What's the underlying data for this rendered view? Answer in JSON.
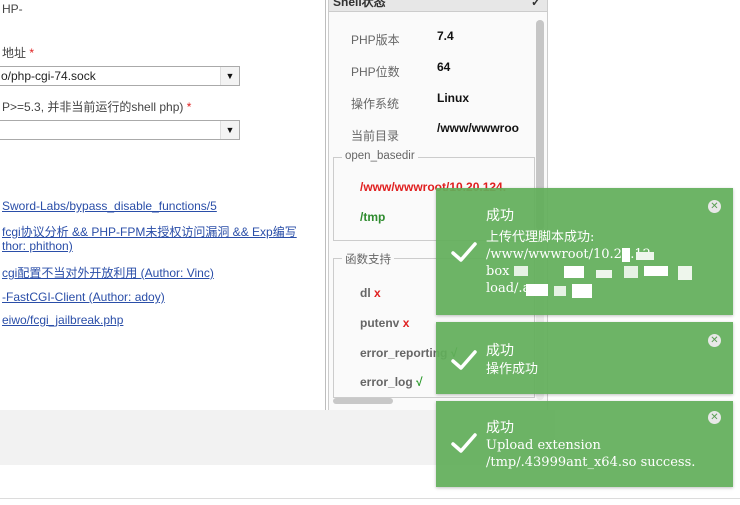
{
  "form": {
    "top_label": "HP-",
    "address_label": "地址",
    "required_mark": "*",
    "socket_value": "o/php-cgi-74.sock",
    "php_label": "P>=5.3, 并非当前运行的shell php)",
    "php_value": "",
    "dropdown_arrow": "▼"
  },
  "links": [
    "Sword-Labs/bypass_disable_functions/5",
    "fcgi协议分析 && PHP-FPM未授权访问漏洞 && Exp编写",
    "thor: phithon)",
    "cgi配置不当对外开放利用 (Author: Vinc)",
    "-FastCGI-Client (Author: adoy)",
    "eiwo/fcgi_jailbreak.php"
  ],
  "info_panel": {
    "header": "Shell状态",
    "header_icon": "✓",
    "rows": [
      {
        "key": "PHP版本",
        "value": "7.4"
      },
      {
        "key": "PHP位数",
        "value": "64"
      },
      {
        "key": "操作系统",
        "value": "Linux"
      },
      {
        "key": "当前目录",
        "value": "/www/wwwroo"
      }
    ],
    "open_basedir_legend": "open_basedir",
    "basedir_paths": [
      "/www/wwwroot/10.20.124.",
      "/tmp"
    ],
    "functions_legend": "函数支持",
    "functions": [
      {
        "name": "dl",
        "status": "x"
      },
      {
        "name": "putenv",
        "status": "x"
      },
      {
        "name": "error_reporting",
        "status": "√"
      },
      {
        "name": "error_log",
        "status": "√"
      }
    ]
  },
  "toasts": [
    {
      "title": "成功",
      "message": "上传代理脚本成功:\n/www/wwwroot/10.20.12\nbox\nload/.ar",
      "close": "✕"
    },
    {
      "title": "成功",
      "message": "操作成功",
      "close": "✕"
    },
    {
      "title": "成功",
      "message": "Upload extension\n/tmp/.43999ant_x64.so success.",
      "close": "✕"
    }
  ],
  "colors": {
    "toast_bg": "#62ae5a",
    "required": "#e02020",
    "link": "#2a4ea8",
    "ok": "#2e8b2e"
  }
}
